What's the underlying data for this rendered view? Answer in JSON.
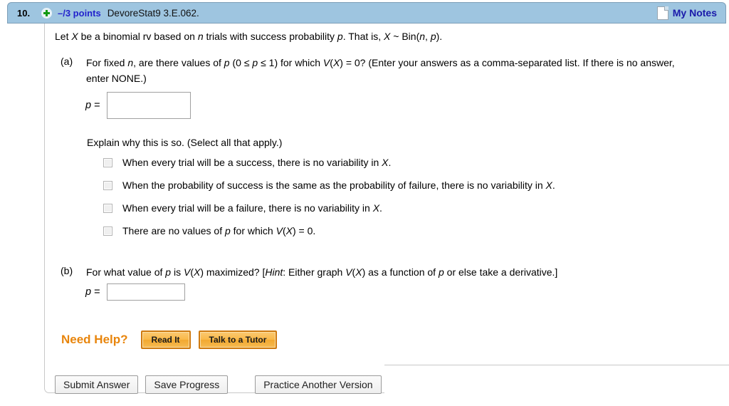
{
  "header": {
    "question_number": "10.",
    "add_icon": "plus-circle-icon",
    "points": "–/3 points",
    "question_code": "DevoreStat9 3.E.062.",
    "notes_icon": "note-page-icon",
    "notes_label": "My Notes",
    "background_color": "#9ec5e0",
    "points_color": "#2222cc"
  },
  "question": {
    "intro": {
      "t1": "Let ",
      "v1": "X",
      "t2": " be a binomial rv based on ",
      "v2": "n",
      "t3": " trials with success probability ",
      "v3": "p",
      "t4": ". That is, ",
      "v4": "X",
      "t5": " ~ Bin(",
      "v5": "n",
      "t6": ", ",
      "v6": "p",
      "t7": ")."
    },
    "parts": [
      {
        "label": "(a)",
        "text": {
          "s1": "For fixed ",
          "v1": "n",
          "s2": ", are there values of ",
          "v2": "p",
          "s3": " (0 ≤ ",
          "v3": "p",
          "s4": " ≤ 1) for which ",
          "v4": "V",
          "s5": "(",
          "v5": "X",
          "s6": ") = 0? (Enter your answers as a comma-separated list. If there is no answer, enter NONE.)"
        },
        "answer": {
          "variable": "p",
          "equals": "=",
          "value": "",
          "placeholder": ""
        },
        "explain_prompt": "Explain why this is so. (Select all that apply.)",
        "choices": [
          {
            "checked": false,
            "s1": "When every trial will be a success, there is no variability in ",
            "v1": "X",
            "s2": "."
          },
          {
            "checked": false,
            "s1": "When the probability of success is the same as the probability of failure, there is no variability in ",
            "v1": "X",
            "s2": "."
          },
          {
            "checked": false,
            "s1": "When every trial will be a failure, there is no variability in ",
            "v1": "X",
            "s2": "."
          },
          {
            "checked": false,
            "s1": "There are no values of ",
            "v1": "p",
            "s2": " for which ",
            "v2": "V",
            "s3": "(",
            "v3": "X",
            "s4": ") = 0."
          }
        ]
      },
      {
        "label": "(b)",
        "text": {
          "s1": "For what value of ",
          "v1": "p",
          "s2": " is ",
          "v2": "V",
          "s3": "(",
          "v3": "X",
          "s4": ") maximized? [",
          "v4": "Hint",
          "s5": ": Either graph ",
          "v5": "V",
          "s6": "(",
          "v6": "X",
          "s7": ") as a function of ",
          "v7": "p",
          "s8": " or else take a derivative.]"
        },
        "answer": {
          "variable": "p",
          "equals": "=",
          "value": "",
          "placeholder": ""
        }
      }
    ]
  },
  "help": {
    "label": "Need Help?",
    "label_color": "#e8850c",
    "buttons": [
      {
        "label": "Read It"
      },
      {
        "label": "Talk to a Tutor"
      }
    ]
  },
  "footer": {
    "buttons": [
      {
        "label": "Submit Answer"
      },
      {
        "label": "Save Progress"
      },
      {
        "label": "Practice Another Version"
      }
    ]
  }
}
